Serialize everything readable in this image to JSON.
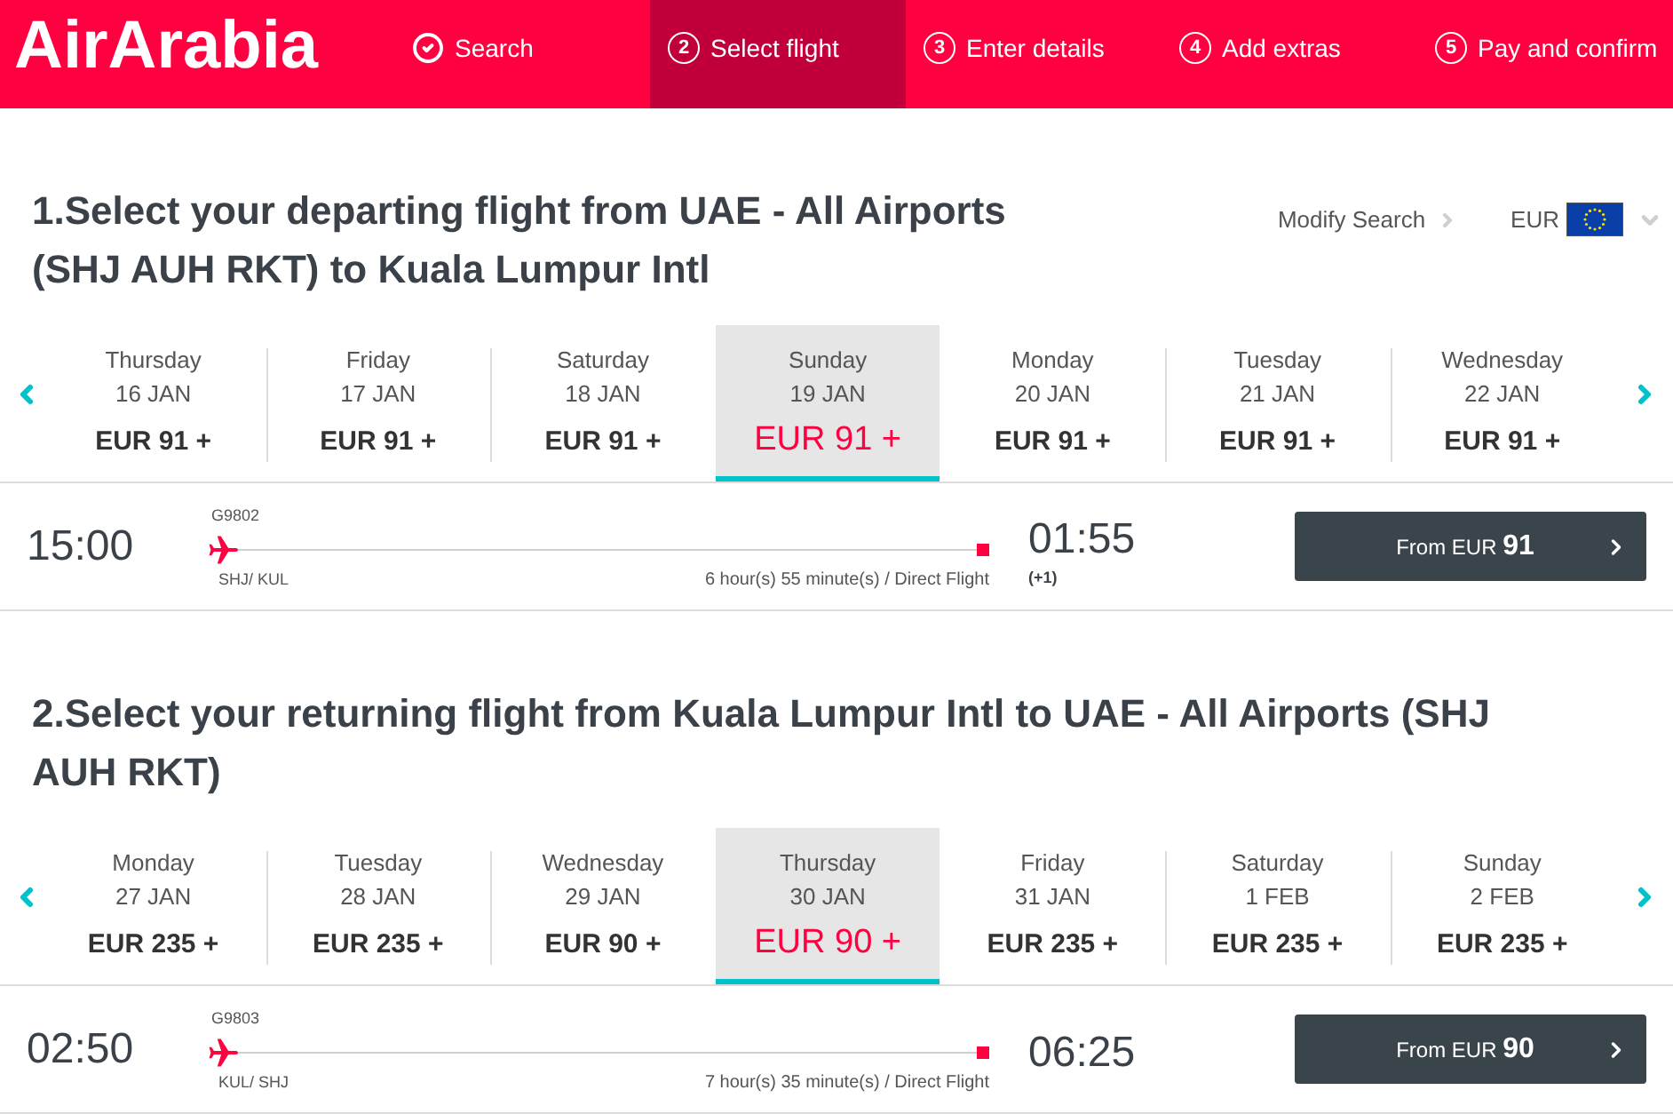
{
  "header": {
    "logo": "AirArabia",
    "steps": [
      {
        "kind": "done",
        "label": "Search",
        "selected": false
      },
      {
        "kind": "numbered",
        "number": "2",
        "label": "Select flight",
        "selected": true
      },
      {
        "kind": "numbered",
        "number": "3",
        "label": "Enter details",
        "selected": false
      },
      {
        "kind": "numbered",
        "number": "4",
        "label": "Add extras",
        "selected": false
      },
      {
        "kind": "numbered",
        "number": "5",
        "label": "Pay and confirm",
        "selected": false
      }
    ]
  },
  "search_tools": {
    "modify_search": "Modify Search",
    "currency": "EUR"
  },
  "sections": [
    {
      "title": "1.Select your departing flight from UAE - All Airports (SHJ AUH RKT) to Kuala Lumpur Intl",
      "dates": [
        {
          "day": "Thursday",
          "date": "16 JAN",
          "price": "EUR 91 +",
          "selected": false
        },
        {
          "day": "Friday",
          "date": "17 JAN",
          "price": "EUR 91 +",
          "selected": false
        },
        {
          "day": "Saturday",
          "date": "18 JAN",
          "price": "EUR 91 +",
          "selected": false
        },
        {
          "day": "Sunday",
          "date": "19 JAN",
          "price": "EUR 91 +",
          "selected": true
        },
        {
          "day": "Monday",
          "date": "20 JAN",
          "price": "EUR 91 +",
          "selected": false
        },
        {
          "day": "Tuesday",
          "date": "21 JAN",
          "price": "EUR 91 +",
          "selected": false
        },
        {
          "day": "Wednesday",
          "date": "22 JAN",
          "price": "EUR 91 +",
          "selected": false
        }
      ],
      "flights": [
        {
          "departure": "15:00",
          "flight_number": "G9802",
          "route": "SHJ/ KUL",
          "duration": "6 hour(s) 55 minute(s) / Direct Flight",
          "arrival": "01:55",
          "next_day": "(+1)",
          "button": "From EUR **91**"
        }
      ]
    },
    {
      "title": "2.Select your returning flight from Kuala Lumpur Intl to UAE - All Airports (SHJ AUH RKT)",
      "dates": [
        {
          "day": "Monday",
          "date": "27 JAN",
          "price": "EUR 235 +",
          "selected": false
        },
        {
          "day": "Tuesday",
          "date": "28 JAN",
          "price": "EUR 235 +",
          "selected": false
        },
        {
          "day": "Wednesday",
          "date": "29 JAN",
          "price": "EUR 90 +",
          "selected": false
        },
        {
          "day": "Thursday",
          "date": "30 JAN",
          "price": "EUR 90 +",
          "selected": true
        },
        {
          "day": "Friday",
          "date": "31 JAN",
          "price": "EUR 235 +",
          "selected": false
        },
        {
          "day": "Saturday",
          "date": "1 FEB",
          "price": "EUR 235 +",
          "selected": false
        },
        {
          "day": "Sunday",
          "date": "2 FEB",
          "price": "EUR 235 +",
          "selected": false
        }
      ],
      "flights": [
        {
          "departure": "02:50",
          "flight_number": "G9803",
          "route": "KUL/ SHJ",
          "duration": "7 hour(s) 35 minute(s) / Direct Flight",
          "arrival": "06:25",
          "button": "From EUR **90**"
        }
      ]
    }
  ]
}
